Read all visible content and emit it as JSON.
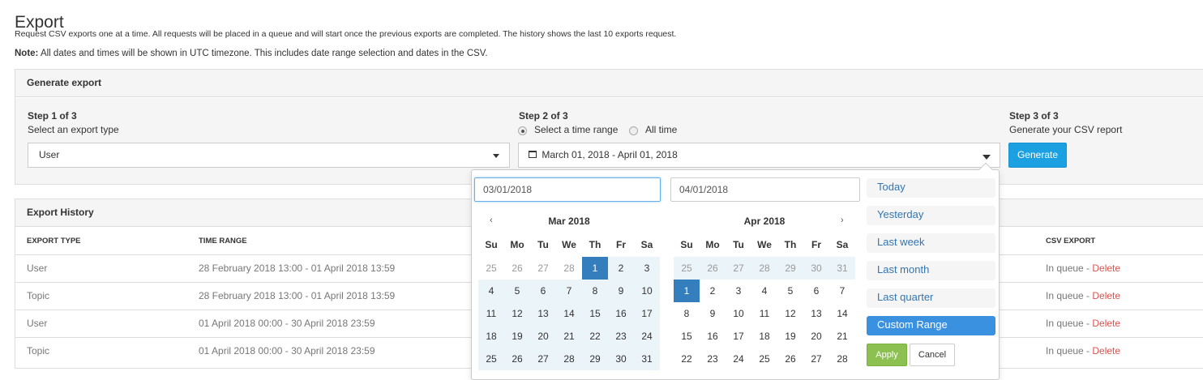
{
  "page": {
    "title": "Export",
    "intro": "Request CSV exports one at a time. All requests will be placed in a queue and will start once the previous exports are completed. The history shows the last 10 exports request.",
    "note_label": "Note:",
    "note_text": " All dates and times will be shown in UTC timezone. This includes date range selection and dates in the CSV."
  },
  "generate": {
    "heading": "Generate export",
    "step1": {
      "title": "Step 1 of 3",
      "subtitle": "Select an export type",
      "value": "User"
    },
    "step2": {
      "title": "Step 2 of 3",
      "option_range": "Select a time range",
      "option_all": "All time",
      "selected": "range",
      "value": "March 01, 2018 - April 01, 2018"
    },
    "step3": {
      "title": "Step 3 of 3",
      "subtitle": "Generate your CSV report",
      "button": "Generate"
    }
  },
  "history": {
    "heading": "Export History",
    "columns": {
      "type": "EXPORT TYPE",
      "range": "TIME RANGE",
      "csv": "CSV EXPORT"
    },
    "rows": [
      {
        "type": "User",
        "range": "28 February 2018 13:00 - 01 April 2018 13:59",
        "status": "In queue - ",
        "action": "Delete"
      },
      {
        "type": "Topic",
        "range": "28 February 2018 13:00 - 01 April 2018 13:59",
        "status": "In queue - ",
        "action": "Delete"
      },
      {
        "type": "User",
        "range": "01 April 2018 00:00 - 30 April 2018 23:59",
        "status": "In queue - ",
        "action": "Delete"
      },
      {
        "type": "Topic",
        "range": "01 April 2018 00:00 - 30 April 2018 23:59",
        "status": "In queue - ",
        "action": "Delete"
      }
    ]
  },
  "picker": {
    "start_input": "03/01/2018",
    "end_input": "04/01/2018",
    "prev_icon": "‹",
    "next_icon": "›",
    "weekdays": [
      "Su",
      "Mo",
      "Tu",
      "We",
      "Th",
      "Fr",
      "Sa"
    ],
    "left": {
      "title": "Mar 2018",
      "weeks": [
        [
          "25",
          "26",
          "27",
          "28",
          "1",
          "2",
          "3"
        ],
        [
          "4",
          "5",
          "6",
          "7",
          "8",
          "9",
          "10"
        ],
        [
          "11",
          "12",
          "13",
          "14",
          "15",
          "16",
          "17"
        ],
        [
          "18",
          "19",
          "20",
          "21",
          "22",
          "23",
          "24"
        ],
        [
          "25",
          "26",
          "27",
          "28",
          "29",
          "30",
          "31"
        ]
      ]
    },
    "right": {
      "title": "Apr 2018",
      "weeks": [
        [
          "25",
          "26",
          "27",
          "28",
          "29",
          "30",
          "31"
        ],
        [
          "1",
          "2",
          "3",
          "4",
          "5",
          "6",
          "7"
        ],
        [
          "8",
          "9",
          "10",
          "11",
          "12",
          "13",
          "14"
        ],
        [
          "15",
          "16",
          "17",
          "18",
          "19",
          "20",
          "21"
        ],
        [
          "22",
          "23",
          "24",
          "25",
          "26",
          "27",
          "28"
        ]
      ]
    },
    "ranges": [
      "Today",
      "Yesterday",
      "Last week",
      "Last month",
      "Last quarter",
      "Custom Range"
    ],
    "active_range": "Custom Range",
    "apply": "Apply",
    "cancel": "Cancel"
  },
  "colors": {
    "primary": "#1ba1e2",
    "delete": "#d9534f",
    "range_active": "#3a91e0",
    "apply": "#8cc152",
    "selected_day": "#357ebd"
  }
}
